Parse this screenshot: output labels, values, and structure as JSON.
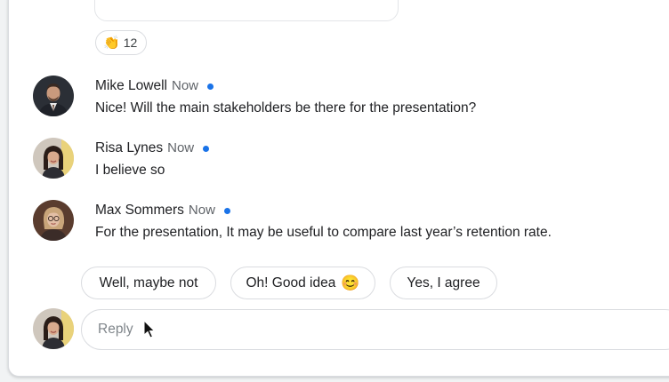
{
  "reaction": {
    "emoji": "👏",
    "emoji_icon": "clapping-hands-icon",
    "count": "12"
  },
  "messages": [
    {
      "name": "Mike Lowell",
      "time": "Now",
      "text": "Nice! Will the main stakeholders be there for the presentation?",
      "unread": true
    },
    {
      "name": "Risa Lynes",
      "time": "Now",
      "text": "I believe so",
      "unread": true
    },
    {
      "name": "Max Sommers",
      "time": "Now",
      "text": "For the presentation, It may be useful to compare last year’s retention rate.",
      "unread": true
    }
  ],
  "smart_replies": [
    {
      "label": "Well, maybe not",
      "emoji": ""
    },
    {
      "label": "Oh! Good idea",
      "emoji": "😊"
    },
    {
      "label": "Yes, I agree",
      "emoji": ""
    }
  ],
  "reply": {
    "placeholder": "Reply",
    "value": ""
  },
  "colors": {
    "unread_dot": "#1a73e8",
    "border": "#dadce0",
    "background": "#ffffff"
  }
}
